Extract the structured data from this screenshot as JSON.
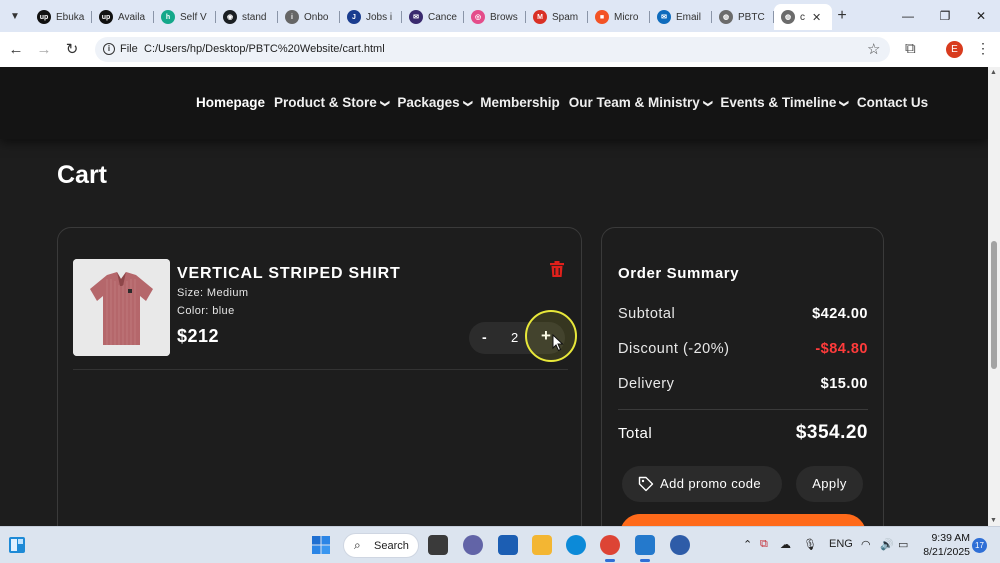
{
  "browser": {
    "tabs": [
      {
        "label": "Ebuka",
        "icon": "upwork-icon",
        "color": "#111111",
        "glyph": "up"
      },
      {
        "label": "Availa",
        "icon": "upwork-icon",
        "color": "#111111",
        "glyph": "up"
      },
      {
        "label": "Self V",
        "icon": "self-icon",
        "color": "#14a88a",
        "glyph": "h"
      },
      {
        "label": "stand",
        "icon": "github-icon",
        "color": "#1b1f23",
        "glyph": "◉"
      },
      {
        "label": "Onbo",
        "icon": "info-icon",
        "color": "#666666",
        "glyph": "i"
      },
      {
        "label": "Jobs i",
        "icon": "jobs-icon",
        "color": "#1a3d8f",
        "glyph": "J"
      },
      {
        "label": "Cance",
        "icon": "mail-icon",
        "color": "#3a2a6e",
        "glyph": "✉"
      },
      {
        "label": "Brows",
        "icon": "dribbble-icon",
        "color": "#e44d8a",
        "glyph": "◎"
      },
      {
        "label": "Spam",
        "icon": "gmail-icon",
        "color": "#d93025",
        "glyph": "M"
      },
      {
        "label": "Micro",
        "icon": "microsoft-icon",
        "color": "#f35325",
        "glyph": "■"
      },
      {
        "label": "Email",
        "icon": "outlook-icon",
        "color": "#0f6cbd",
        "glyph": "✉"
      },
      {
        "label": "PBTC",
        "icon": "globe-icon",
        "color": "#6b6b6b",
        "glyph": "◍"
      },
      {
        "label": "c",
        "icon": "globe-icon",
        "color": "#6b6b6b",
        "glyph": "◍",
        "active": true
      }
    ],
    "new_tab": "+",
    "scheme": "File",
    "url": "C:/Users/hp/Desktop/PBTC%20Website/cart.html",
    "profile_initial": "E"
  },
  "site": {
    "nav": [
      {
        "label": "Homepage",
        "dropdown": false
      },
      {
        "label": "Product & Store",
        "dropdown": true
      },
      {
        "label": "Packages",
        "dropdown": true
      },
      {
        "label": "Membership",
        "dropdown": false
      },
      {
        "label": "Our Team & Ministry",
        "dropdown": true
      },
      {
        "label": "Events & Timeline",
        "dropdown": true
      },
      {
        "label": "Contact Us",
        "dropdown": false
      }
    ]
  },
  "cart": {
    "title": "Cart",
    "item": {
      "name": "VERTICAL STRIPED SHIRT",
      "size": "Size: Medium",
      "color": "Color: blue",
      "price": "$212",
      "quantity": "2",
      "minus": "-",
      "plus": "+"
    }
  },
  "summary": {
    "title": "Order Summary",
    "subtotal_label": "Subtotal",
    "subtotal": "$424.00",
    "discount_label": "Discount (-20%)",
    "discount": "-$84.80",
    "delivery_label": "Delivery",
    "delivery": "$15.00",
    "total_label": "Total",
    "total": "$354.20",
    "promo_label": "Add promo code",
    "apply_label": "Apply"
  },
  "colors": {
    "accent": "#ff6a1a",
    "discount": "#ff3b3b",
    "trash": "#e0201b"
  },
  "taskbar": {
    "search_label": "Search",
    "language": "ENG",
    "time": "9:39 AM",
    "date": "8/21/2025",
    "notifications": "17"
  }
}
